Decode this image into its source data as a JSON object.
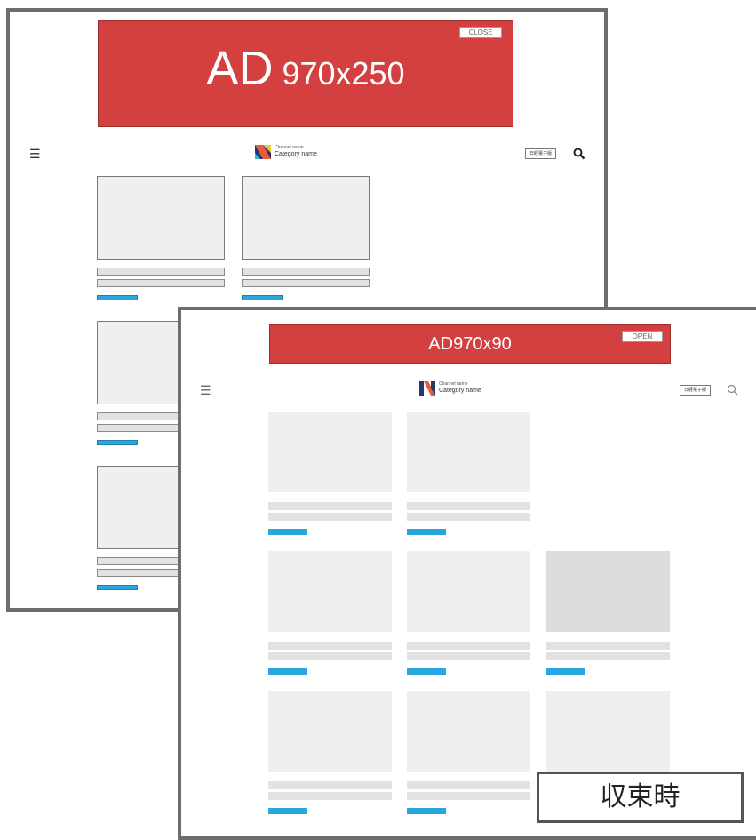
{
  "expanded_view": {
    "ad": {
      "label_main": "AD",
      "label_size": "970x250",
      "close_button": "CLOSE"
    },
    "header": {
      "channel_name": "Channel name",
      "category_name": "Category name",
      "paper_button": "日経電子版"
    }
  },
  "collapsed_view": {
    "ad": {
      "label": "AD970x90",
      "open_button": "OPEN"
    },
    "header": {
      "channel_name": "Channel name",
      "category_name": "Category name",
      "paper_button": "日経電子版"
    }
  },
  "caption": "収束時",
  "colors": {
    "ad_red": "#d44040",
    "tag_blue": "#29a6e0",
    "frame_gray": "#6e6e6e",
    "placeholder_gray": "#eeeeee"
  },
  "icons": [
    "hamburger-menu-icon",
    "search-icon",
    "channel-logo-icon"
  ]
}
